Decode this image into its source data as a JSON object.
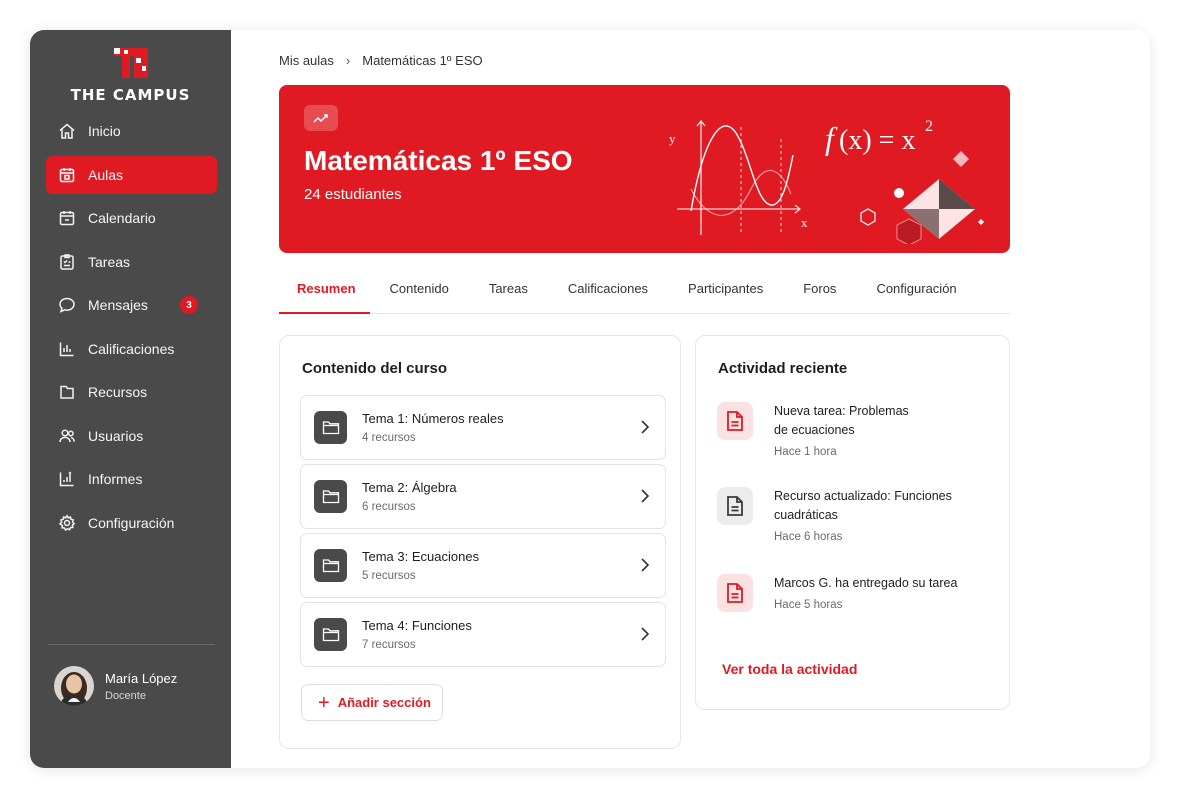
{
  "brand": {
    "name": "THE CAMPUS"
  },
  "sidebar": {
    "items": [
      {
        "label": "Inicio",
        "icon": "home-icon"
      },
      {
        "label": "Aulas",
        "icon": "classroom-icon",
        "active": true
      },
      {
        "label": "Calendario",
        "icon": "calendar-icon"
      },
      {
        "label": "Tareas",
        "icon": "clipboard-icon"
      },
      {
        "label": "Mensajes",
        "icon": "chat-icon",
        "badge": "3"
      },
      {
        "label": "Calificaciones",
        "icon": "bar-chart-icon"
      },
      {
        "label": "Recursos",
        "icon": "file-icon"
      },
      {
        "label": "Usuarios",
        "icon": "users-icon"
      },
      {
        "label": "Informes",
        "icon": "report-icon"
      },
      {
        "label": "Configuración",
        "icon": "gear-icon"
      }
    ],
    "user": {
      "name": "María López",
      "role": "Docente"
    }
  },
  "breadcrumb": {
    "root": "Mis aulas",
    "current": "Matemáticas 1º ESO"
  },
  "banner": {
    "title": "Matemáticas 1º ESO",
    "subtitle": "24 estudiantes"
  },
  "tabs": [
    "Resumen",
    "Contenido",
    "Tareas",
    "Calificaciones",
    "Participantes",
    "Foros",
    "Configuración"
  ],
  "course": {
    "title": "Contenido del curso",
    "topics": [
      {
        "name": "Tema 1: Números reales",
        "count": "4 recursos"
      },
      {
        "name": "Tema 2: Álgebra",
        "count": "6 recursos"
      },
      {
        "name": "Tema 3: Ecuaciones",
        "count": "5 recursos"
      },
      {
        "name": "Tema 4: Funciones",
        "count": "7 recursos"
      }
    ],
    "add_label": "Añadir sección"
  },
  "activity": {
    "title": "Actividad reciente",
    "items": [
      {
        "line1": "Nueva tarea: Problemas",
        "line2": "de ecuaciones",
        "time": "Hace 1 hora",
        "tone": "red"
      },
      {
        "line1": "Recurso actualizado: Funciones",
        "line2": "cuadráticas",
        "time": "Hace 6 horas",
        "tone": "grey"
      },
      {
        "line1": "Marcos G. ha entregado su tarea",
        "line2": "",
        "time": "Hace 5 horas",
        "tone": "red"
      }
    ],
    "see_all": "Ver toda la actividad"
  },
  "colors": {
    "accent": "#e01a22",
    "sidebar": "#4a4a4a"
  }
}
